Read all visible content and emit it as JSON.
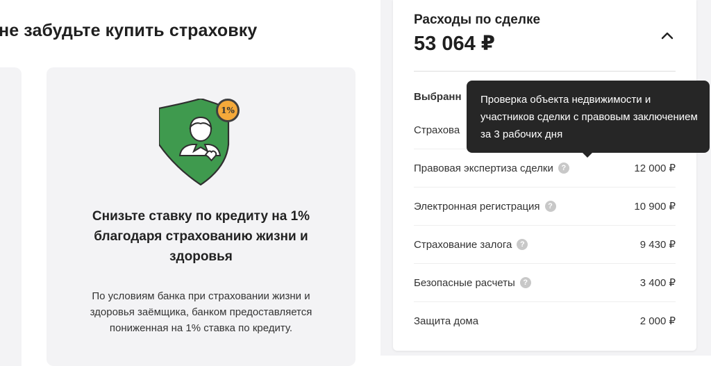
{
  "promo": {
    "section_title": "не забудьте купить страховку",
    "badge_text": "1%",
    "card_title": "Снизьте ставку по кредиту на 1% благодаря страхованию жизни и здоровья",
    "card_text": "По условиям банка при страховании жизни и здоровья заёмщика, банком предоставляется пониженная на 1% ставка по кредиту.",
    "shield_color": "#3f9a4e",
    "badge_color": "#f4a93a"
  },
  "expenses": {
    "title": "Расходы по сделке",
    "total": "53 064 ₽",
    "selected_heading": "Выбранн",
    "rows": [
      {
        "label": "Страхова",
        "value": ""
      },
      {
        "label": "Правовая экспертиза сделки",
        "value": "12 000 ₽",
        "help": "?"
      },
      {
        "label": "Электронная регистрация",
        "value": "10 900 ₽",
        "help": "?"
      },
      {
        "label": "Страхование залога",
        "value": "9 430 ₽",
        "help": "?"
      },
      {
        "label": "Безопасные расчеты",
        "value": "3 400 ₽",
        "help": "?"
      },
      {
        "label": "Защита дома",
        "value": "2 000 ₽"
      }
    ]
  },
  "tooltip": {
    "text": "Проверка объекта недвижимости и участников сделки с правовым заключением за 3 рабочих дня"
  },
  "icons": {
    "collapse": "chevron-up-icon",
    "help": "question-circle-icon",
    "shield": "shield-person-icon"
  }
}
